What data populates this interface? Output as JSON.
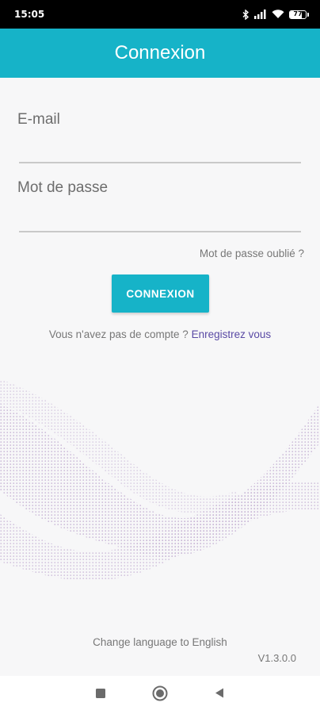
{
  "status_bar": {
    "time": "15:05",
    "battery_level": "77",
    "battery_fraction": 0.77,
    "icons": [
      "bluetooth-icon",
      "signal-icon",
      "wifi-icon",
      "battery-icon"
    ]
  },
  "app_bar": {
    "title": "Connexion"
  },
  "form": {
    "email": {
      "label": "E-mail",
      "value": "",
      "placeholder": ""
    },
    "password": {
      "label": "Mot de passe",
      "value": "",
      "placeholder": ""
    },
    "forgot_password": "Mot de passe oublié ?",
    "login_button": "CONNEXION",
    "no_account_text": "Vous n'avez pas de compte ?",
    "register_link": "Enregistrez vous"
  },
  "footer": {
    "change_language": "Change language to English",
    "version": "V1.3.0.0"
  },
  "colors": {
    "accent": "#16b3c8",
    "link": "#5a4aa5",
    "background": "#f7f7f8"
  },
  "nav_bar": {
    "buttons": [
      "recents-square-icon",
      "home-circle-icon",
      "back-triangle-icon"
    ]
  }
}
